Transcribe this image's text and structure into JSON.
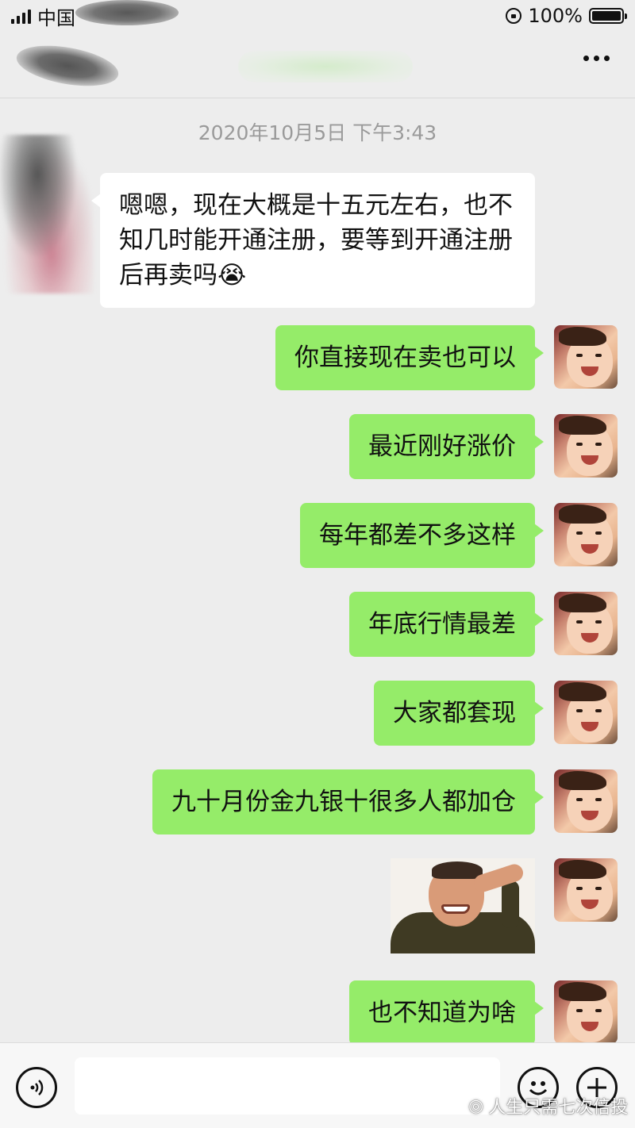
{
  "status_bar": {
    "carrier": "中国",
    "battery": "100%"
  },
  "header": {
    "more_label": "more"
  },
  "chat": {
    "timestamp": "2020年10月5日 下午3:43",
    "incoming": [
      {
        "text": "嗯嗯，现在大概是十五元左右，也不知几时能开通注册，要等到开通注册后再卖吗😭"
      }
    ],
    "outgoing": [
      {
        "text": "你直接现在卖也可以"
      },
      {
        "text": "最近刚好涨价"
      },
      {
        "text": "每年都差不多这样"
      },
      {
        "text": "年底行情最差"
      },
      {
        "text": "大家都套现"
      },
      {
        "text": "九十月份金九银十很多人都加仓"
      },
      {
        "text": "也不知道为啥"
      }
    ]
  },
  "watermark": "人生只需七次倍投",
  "colors": {
    "outgoing_bubble": "#95ec69",
    "incoming_bubble": "#ffffff",
    "background": "#ededed"
  }
}
